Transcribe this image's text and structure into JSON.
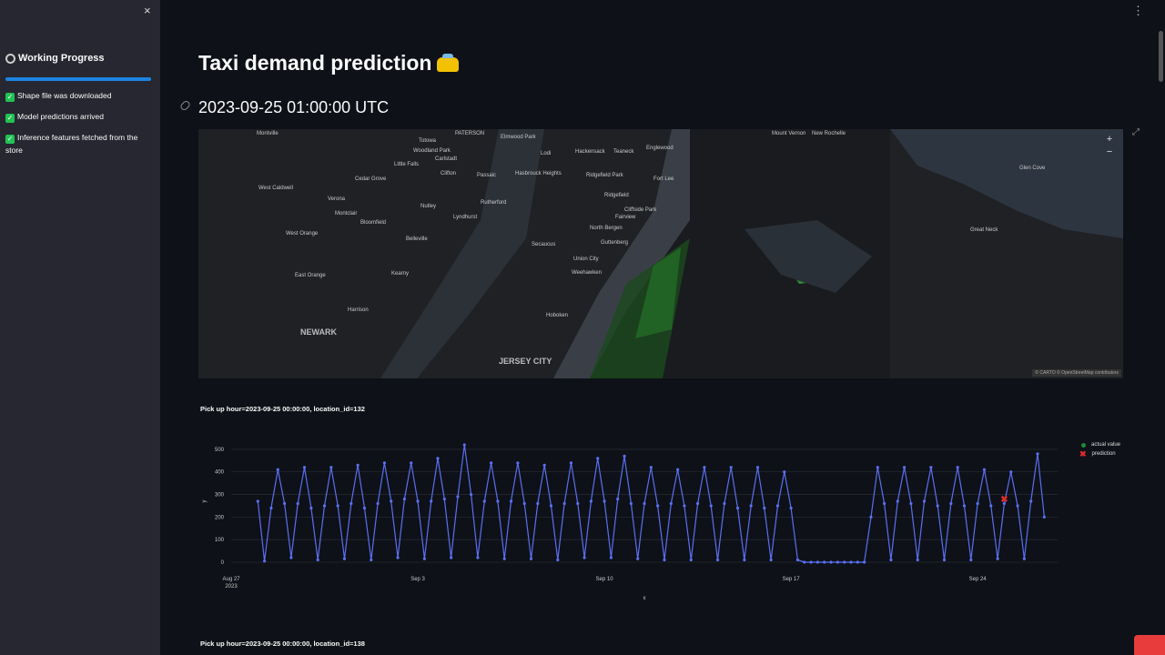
{
  "sidebar": {
    "close_icon": "×",
    "title": "Working Progress",
    "progress_fraction": 1.0,
    "items": [
      {
        "label": "Shape file was downloaded"
      },
      {
        "label": "Model predictions arrived"
      },
      {
        "label": "Inference features fetched from the store"
      }
    ]
  },
  "header": {
    "menu_icon": "⋮"
  },
  "main": {
    "title": "Taxi demand prediction",
    "subtitle": "2023-09-25 01:00:00 UTC"
  },
  "map": {
    "zoom_in": "+",
    "zoom_out": "−",
    "attribution": "© CARTO © OpenStreetMap contributors",
    "labels": [
      {
        "text": "PATERSON",
        "big": false
      },
      {
        "text": "Montville",
        "big": false
      },
      {
        "text": "Totowa",
        "big": false
      },
      {
        "text": "Elmwood Park",
        "big": false
      },
      {
        "text": "Woodland Park",
        "big": false
      },
      {
        "text": "Little Falls",
        "big": false
      },
      {
        "text": "Clifton",
        "big": false
      },
      {
        "text": "Passaic",
        "big": false
      },
      {
        "text": "Hasbrouck Heights",
        "big": false
      },
      {
        "text": "Ridgefield Park",
        "big": false
      },
      {
        "text": "Hackensack",
        "big": false
      },
      {
        "text": "Teaneck",
        "big": false
      },
      {
        "text": "Englewood",
        "big": false
      },
      {
        "text": "Fort Lee",
        "big": false
      },
      {
        "text": "Ridgefield",
        "big": false
      },
      {
        "text": "Cliffside Park",
        "big": false
      },
      {
        "text": "Fairview",
        "big": false
      },
      {
        "text": "North Bergen",
        "big": false
      },
      {
        "text": "Guttenberg",
        "big": false
      },
      {
        "text": "Secaucus",
        "big": false
      },
      {
        "text": "Union City",
        "big": false
      },
      {
        "text": "Weehawken",
        "big": false
      },
      {
        "text": "Rutherford",
        "big": false
      },
      {
        "text": "Lyndhurst",
        "big": false
      },
      {
        "text": "Nutley",
        "big": false
      },
      {
        "text": "Belleville",
        "big": false
      },
      {
        "text": "Kearny",
        "big": false
      },
      {
        "text": "Harrison",
        "big": false
      },
      {
        "text": "Hoboken",
        "big": false
      },
      {
        "text": "NEWARK",
        "big": true
      },
      {
        "text": "JERSEY CITY",
        "big": true
      },
      {
        "text": "East Orange",
        "big": false
      },
      {
        "text": "West Orange",
        "big": false
      },
      {
        "text": "Bloomfield",
        "big": false
      },
      {
        "text": "Montclair",
        "big": false
      },
      {
        "text": "Verona",
        "big": false
      },
      {
        "text": "West Caldwell",
        "big": false
      },
      {
        "text": "Cedar Grove",
        "big": false
      },
      {
        "text": "Mount Vernon",
        "big": false
      },
      {
        "text": "New Rochelle",
        "big": false
      },
      {
        "text": "Glen Cove",
        "big": false
      },
      {
        "text": "Great Neck",
        "big": false
      },
      {
        "text": "Carlstadt",
        "big": false
      },
      {
        "text": "Lodi",
        "big": false
      }
    ]
  },
  "chart1": {
    "title": "Pick up hour=2023-09-25 00:00:00, location_id=132"
  },
  "chart2": {
    "title": "Pick up hour=2023-09-25 00:00:00, location_id=138"
  },
  "chart_data": {
    "type": "line",
    "title": "Pick up hour=2023-09-25 00:00:00, location_id=132",
    "xlabel": "x",
    "ylabel": "y",
    "ylim": [
      0,
      540
    ],
    "yticks": [
      0,
      100,
      200,
      300,
      400,
      500
    ],
    "xticks": [
      {
        "label": "Aug 27",
        "sublabel": "2023",
        "date": "2023-08-27"
      },
      {
        "label": "Sep 3",
        "sublabel": "",
        "date": "2023-09-03"
      },
      {
        "label": "Sep 10",
        "sublabel": "",
        "date": "2023-09-10"
      },
      {
        "label": "Sep 17",
        "sublabel": "",
        "date": "2023-09-17"
      },
      {
        "label": "Sep 24",
        "sublabel": "",
        "date": "2023-09-24"
      }
    ],
    "xrange": [
      "2023-08-27",
      "2023-09-27"
    ],
    "series": [
      {
        "name": "actual value",
        "color": "#5b6ff2",
        "start": "2023-08-28T00:00",
        "step_hours": 6,
        "values": [
          270,
          5,
          240,
          410,
          260,
          20,
          260,
          420,
          240,
          10,
          250,
          420,
          250,
          15,
          260,
          430,
          240,
          10,
          260,
          440,
          270,
          20,
          280,
          440,
          270,
          15,
          270,
          460,
          280,
          20,
          290,
          520,
          300,
          20,
          270,
          440,
          270,
          15,
          270,
          440,
          260,
          15,
          260,
          430,
          250,
          10,
          260,
          440,
          260,
          20,
          270,
          460,
          270,
          20,
          280,
          470,
          260,
          15,
          260,
          420,
          250,
          10,
          260,
          410,
          250,
          10,
          260,
          420,
          250,
          10,
          260,
          420,
          240,
          10,
          250,
          420,
          240,
          10,
          250,
          400,
          240,
          10,
          0,
          0,
          0,
          0,
          0,
          0,
          0,
          0,
          0,
          0,
          200,
          420,
          260,
          10,
          270,
          420,
          260,
          10,
          270,
          420,
          250,
          10,
          260,
          420,
          250,
          10,
          260,
          410,
          250,
          15,
          260,
          400,
          250,
          15,
          270,
          480,
          200
        ],
        "legend_dot_color": "#1e8a3a"
      },
      {
        "name": "prediction",
        "color": "#e02c2c",
        "points": [
          {
            "x": "2023-09-25T00:00",
            "y": 280
          }
        ]
      }
    ]
  }
}
